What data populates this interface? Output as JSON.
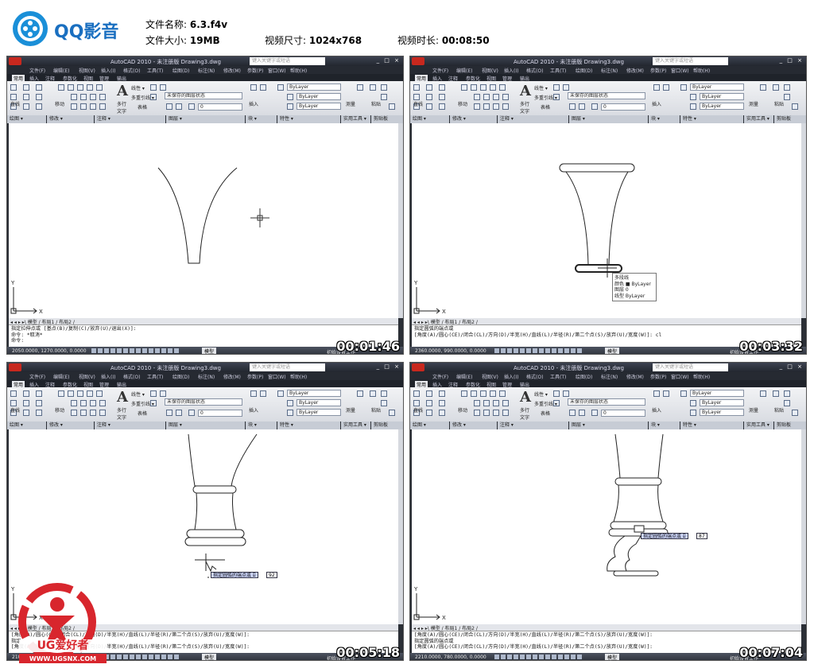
{
  "player": {
    "name": "QQ影音",
    "brand_color": "#1a6fc0"
  },
  "info": {
    "file_name_label": "文件名称:",
    "file_name": "6.3.f4v",
    "file_size_label": "文件大小:",
    "file_size": "19MB",
    "video_dim_label": "视频尺寸:",
    "video_dim": "1024x768",
    "duration_label": "视频时长:",
    "duration": "00:08:50"
  },
  "app": {
    "title": "AutoCAD 2010 - 未注册版",
    "search_placeholder": "键入关键字或短语",
    "window_controls": "_ □ ×",
    "menu": [
      "文件(F)",
      "编辑(E)",
      "视图(V)",
      "插入(I)",
      "格式(O)",
      "工具(T)",
      "绘图(D)",
      "标注(N)",
      "修改(M)",
      "参数(P)",
      "窗口(W)",
      "帮助(H)"
    ],
    "ribbon_tabs": [
      "常用",
      "插入",
      "注释",
      "参数化",
      "视图",
      "管理",
      "输出"
    ],
    "panels": [
      "绘图 ▾",
      "修改 ▾",
      "注释 ▾",
      "图层 ▾",
      "块 ▾",
      "特性 ▾",
      "实用工具 ▾",
      "剪贴板"
    ],
    "draw_tools": [
      "直线"
    ],
    "modify_tools": [
      "移动"
    ],
    "annot_text": "多行\n文字",
    "annot_items": [
      "线性 ▾",
      "多重引线 ▾",
      "表格"
    ],
    "layer_state": "未保存的图层状态",
    "layer_name": "0",
    "bylayer": "ByLayer",
    "insert_label": "插入",
    "measure_label": "测量",
    "paste_label": "粘贴",
    "layout_tabs": "◂ ◂ ▸ ▸\\ 模型 / 布局1 / 布局2 /",
    "model_label": "模型",
    "status_right": "初始设置工作"
  },
  "thumbs": [
    {
      "drawing": "Drawing3.dwg",
      "coords": "2050.0000, 1270.0000, 0.0000",
      "timestamp": "00:01:46",
      "cmd": [
        "指定拉伸点或 [基点(B)/复制(C)/放弃(U)/退出(X)]:",
        "命令: *取消*",
        "命令:"
      ]
    },
    {
      "drawing": "Drawing3.dwg",
      "coords": "2360.0000, 990.0000, 0.0000",
      "timestamp": "00:03:32",
      "cmd": [
        "指定圆弧的端点或",
        "[角度(A)/圆心(CE)/闭合(CL)/方向(D)/半宽(H)/直线(L)/半径(R)/第二个点(S)/放弃(U)/宽度(W)]: cl",
        ""
      ],
      "tooltip": [
        "多段线",
        "颜色  ■ ByLayer",
        "图层  0",
        "线型  ByLayer"
      ]
    },
    {
      "drawing": "Drawing3.dwg",
      "coords": "2100.0000, 1260.0000, 0.0000",
      "timestamp": "00:05:18",
      "cmd": [
        "[角度(A)/圆心(CE)/闭合(CL)/方向(D)/半宽(H)/直线(L)/半径(R)/第二个点(S)/放弃(U)/宽度(W)]:",
        "指定",
        "[角度(A)/圆心(CE)/闭合(CL)/方向(D)/半宽(H)/直线(L)/半径(R)/第二个点(S)/放弃(U)/宽度(W)]:"
      ],
      "dyn_input": "指定圆弧的端点或 ⌸",
      "dyn_value": "92"
    },
    {
      "drawing": "Drawing3.dwg",
      "coords": "2210.0000, 780.0000, 0.0000",
      "timestamp": "00:07:04",
      "cmd": [
        "[角度(A)/圆心(CE)/闭合(CL)/方向(D)/半宽(H)/直线(L)/半径(R)/第二个点(S)/放弃(U)/宽度(W)]:",
        "指定圆弧的端点或",
        "[角度(A)/圆心(CE)/闭合(CL)/方向(D)/半宽(H)/直线(L)/半径(R)/第二个点(S)/放弃(U)/宽度(W)]:"
      ],
      "dyn_input": "指定圆弧的端点或 ⌸",
      "dyn_value": "87"
    }
  ],
  "watermark": {
    "brand": "UG爱好者",
    "url": "WWW.UGSNX.COM",
    "color": "#d8262d"
  }
}
